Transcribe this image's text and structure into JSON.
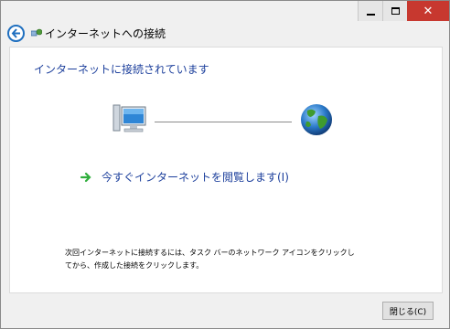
{
  "window": {
    "title": "インターネットへの接続"
  },
  "caption": {
    "minimize": "–",
    "maximize": "□",
    "close": "✕"
  },
  "main": {
    "heading": "インターネットに接続されています",
    "browse_link": "今すぐインターネットを閲覧します(I)",
    "info": "次回インターネットに接続するには、タスク バーのネットワーク アイコンをクリックしてから、作成した接続をクリックします。"
  },
  "footer": {
    "close_label": "閉じる(C)"
  },
  "colors": {
    "accent": "#1c3f9c",
    "close_red": "#c7382f",
    "arrow_green": "#2fae3c"
  }
}
